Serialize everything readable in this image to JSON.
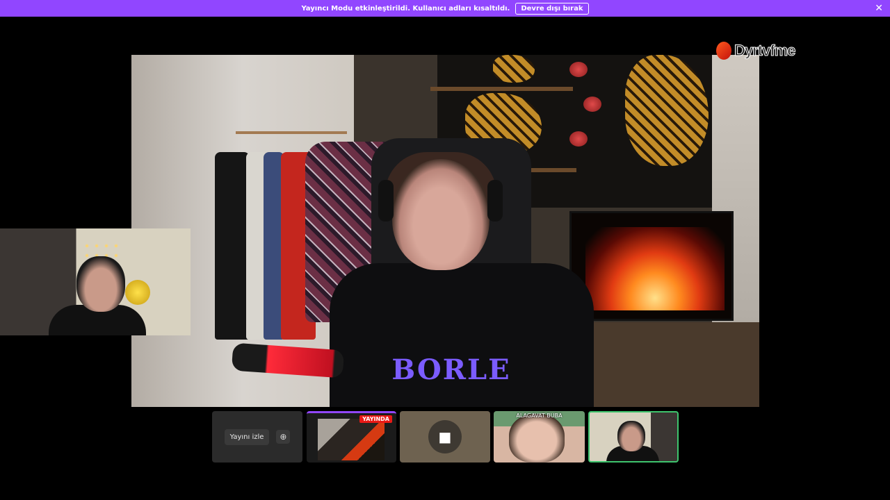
{
  "banner": {
    "message": "Yayıncı Modu etkinleştirildi. Kullanıcı adları kısaltıldı.",
    "disable_label": "Devre dışı bırak",
    "close_icon": "close-icon"
  },
  "stream": {
    "shirt_logo": "BORLE"
  },
  "watermark": {
    "text": "Dyrtvfme"
  },
  "strip": {
    "watch_label": "Yayını izle",
    "watch_icon": "screen-add-icon",
    "live_badge": "YAYINDA",
    "camera_icon": "camera-icon",
    "participant_name": "ALAGAVAT BUBA"
  },
  "colors": {
    "banner": "#9146ff",
    "live": "#e91916",
    "speaking_border": "#3ec46d"
  }
}
